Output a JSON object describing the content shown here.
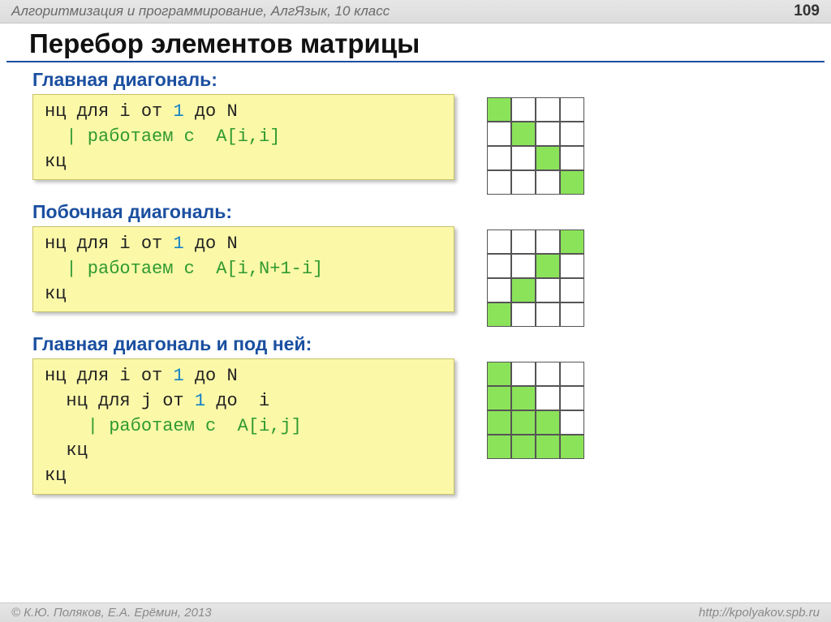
{
  "header": {
    "breadcrumb": "Алгоритмизация и программирование, АлгЯзык, 10 класс",
    "page": "109"
  },
  "title": "Перебор элементов матрицы",
  "sections": [
    {
      "label": "Главная диагональ:",
      "code": {
        "l1a": "нц для i от ",
        "l1n": "1",
        "l1b": " до N",
        "l2": "  | работаем с  A[i,i]",
        "l3": "кц"
      },
      "grid": [
        [
          1,
          0,
          0,
          0
        ],
        [
          0,
          1,
          0,
          0
        ],
        [
          0,
          0,
          1,
          0
        ],
        [
          0,
          0,
          0,
          1
        ]
      ]
    },
    {
      "label": "Побочная диагональ:",
      "code": {
        "l1a": "нц для i от ",
        "l1n": "1",
        "l1b": " до N",
        "l2": "  | работаем с  A[i,N+1-i]",
        "l3": "кц"
      },
      "grid": [
        [
          0,
          0,
          0,
          1
        ],
        [
          0,
          0,
          1,
          0
        ],
        [
          0,
          1,
          0,
          0
        ],
        [
          1,
          0,
          0,
          0
        ]
      ]
    },
    {
      "label": "Главная диагональ и под ней:",
      "code": {
        "l1a": "нц для i от ",
        "l1n": "1",
        "l1b": " до N",
        "l2a": "  нц для j от ",
        "l2n": "1",
        "l2b": " до  i",
        "l3": "    | работаем с  A[i,j]",
        "l4": "  кц",
        "l5": "кц"
      },
      "grid": [
        [
          1,
          0,
          0,
          0
        ],
        [
          1,
          1,
          0,
          0
        ],
        [
          1,
          1,
          1,
          0
        ],
        [
          1,
          1,
          1,
          1
        ]
      ]
    }
  ],
  "footer": {
    "copyright": "© К.Ю. Поляков, Е.А. Ерёмин, 2013",
    "url": "http://kpolyakov.spb.ru"
  }
}
